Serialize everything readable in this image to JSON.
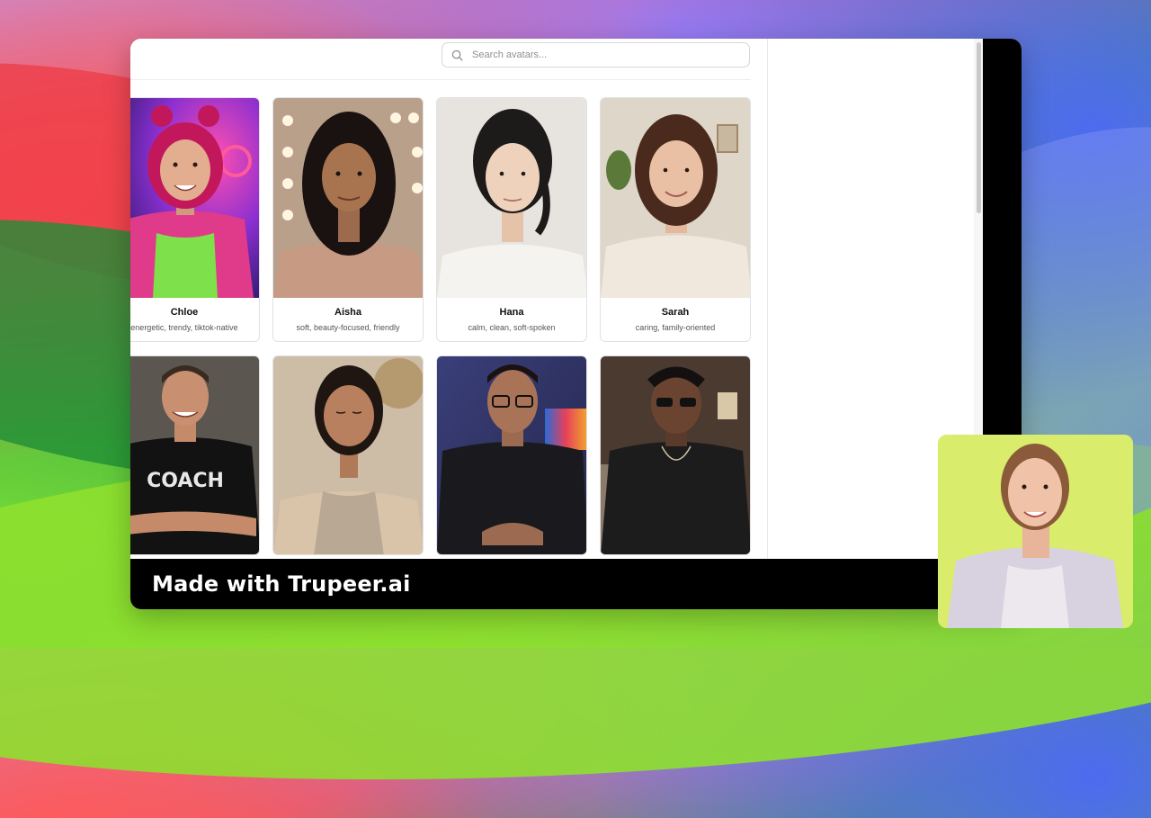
{
  "search": {
    "placeholder": "Search avatars..."
  },
  "avatars_row1": [
    {
      "name": "Chloe",
      "description": "energetic, trendy, tiktok-native"
    },
    {
      "name": "Aisha",
      "description": "soft, beauty-focused, friendly"
    },
    {
      "name": "Hana",
      "description": "calm, clean, soft-spoken"
    },
    {
      "name": "Sarah",
      "description": "caring, family-oriented"
    }
  ],
  "avatars_row2": [
    {
      "shirt_text": "COACH"
    },
    {},
    {},
    {}
  ],
  "watermark": {
    "text": "Made with Trupeer.ai"
  },
  "colors": {
    "presenter_bg": "#d9ec6b",
    "accent_text": "#111111"
  }
}
